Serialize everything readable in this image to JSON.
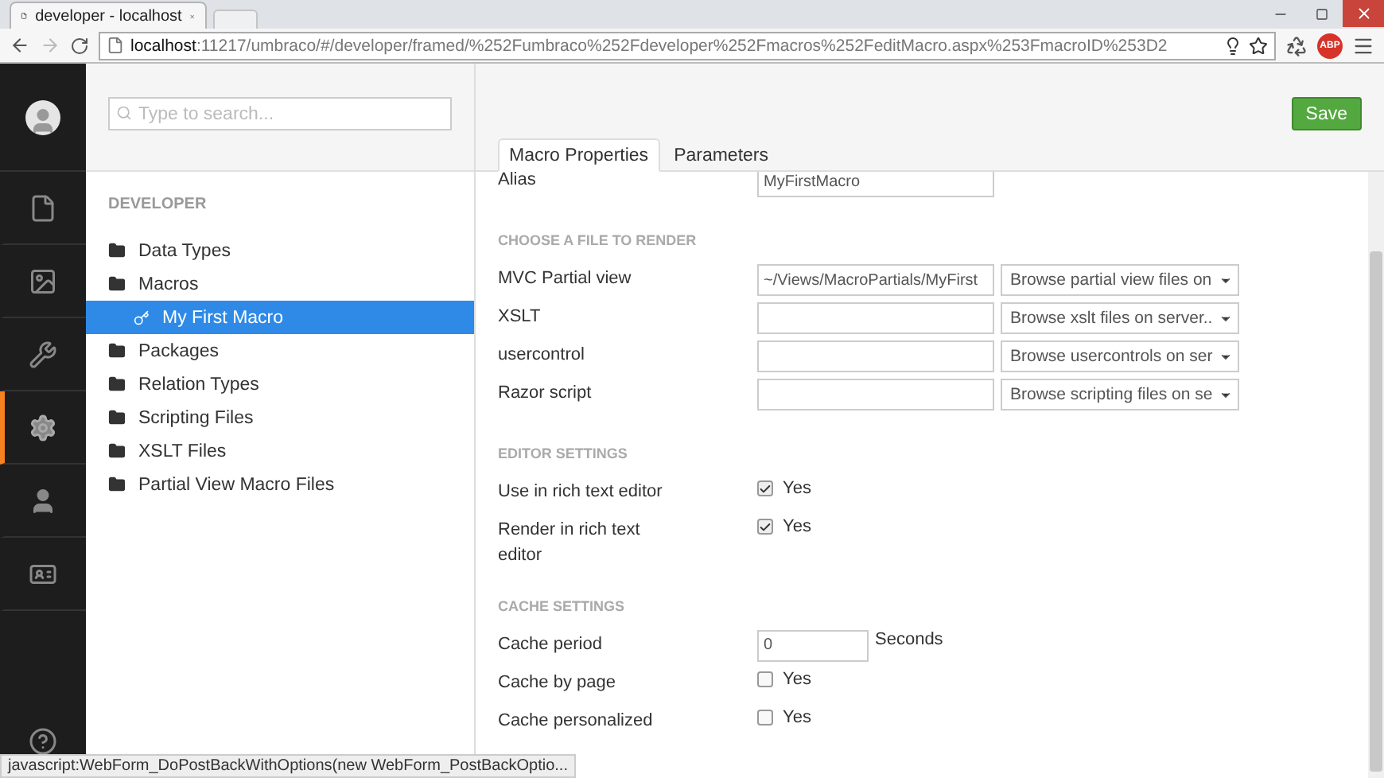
{
  "browser": {
    "tab_title": "developer - localhost",
    "url_host": "localhost",
    "url_path": ":11217/umbraco/#/developer/framed/%252Fumbraco%252Fdeveloper%252Fmacros%252FeditMacro.aspx%253FmacroID%253D2",
    "adblock_label": "ABP"
  },
  "sidebar": {
    "items": [
      {
        "selected": false
      },
      {
        "selected": false
      },
      {
        "selected": false
      },
      {
        "selected": true
      },
      {
        "selected": false
      },
      {
        "selected": false
      }
    ]
  },
  "tree": {
    "search": {
      "placeholder": "Type to search..."
    },
    "heading": "DEVELOPER",
    "items": [
      {
        "label": "Data Types",
        "selected": false
      },
      {
        "label": "Macros",
        "selected": false,
        "children": [
          {
            "label": "My First Macro",
            "selected": true
          }
        ]
      },
      {
        "label": "Packages",
        "selected": false
      },
      {
        "label": "Relation Types",
        "selected": false
      },
      {
        "label": "Scripting Files",
        "selected": false
      },
      {
        "label": "XSLT Files",
        "selected": false
      },
      {
        "label": "Partial View Macro Files",
        "selected": false
      }
    ]
  },
  "editor": {
    "save_button": "Save",
    "tabs": [
      {
        "label": "Macro Properties",
        "selected": true
      },
      {
        "label": "Parameters",
        "selected": false
      }
    ],
    "alias": {
      "label": "Alias",
      "value": "MyFirstMacro"
    },
    "sections": [
      {
        "heading": "CHOOSE A FILE TO RENDER",
        "rows": [
          {
            "kind": "file",
            "label": "MVC Partial view",
            "value": "~/Views/MacroPartials/MyFirst",
            "select": "Browse partial view files on"
          },
          {
            "kind": "file",
            "label": "XSLT",
            "value": "",
            "select": "Browse xslt files on server.."
          },
          {
            "kind": "file",
            "label": "usercontrol",
            "value": "",
            "select": "Browse usercontrols on ser"
          },
          {
            "kind": "file",
            "label": "Razor script",
            "value": "",
            "select": "Browse scripting files on se"
          }
        ]
      },
      {
        "heading": "EDITOR SETTINGS",
        "rows": [
          {
            "kind": "checkbox",
            "label": "Use in rich text editor",
            "checked": true,
            "option": "Yes"
          },
          {
            "kind": "checkbox",
            "label": "Render in rich text editor",
            "checked": true,
            "option": "Yes"
          }
        ]
      },
      {
        "heading": "CACHE SETTINGS",
        "rows": [
          {
            "kind": "number",
            "label": "Cache period",
            "value": "0",
            "unit": "Seconds"
          },
          {
            "kind": "checkbox",
            "label": "Cache by page",
            "checked": false,
            "option": "Yes"
          },
          {
            "kind": "checkbox",
            "label": "Cache personalized",
            "checked": false,
            "option": "Yes"
          }
        ]
      }
    ]
  },
  "status_bar": "javascript:WebForm_DoPostBackWithOptions(new WebForm_PostBackOptio..."
}
